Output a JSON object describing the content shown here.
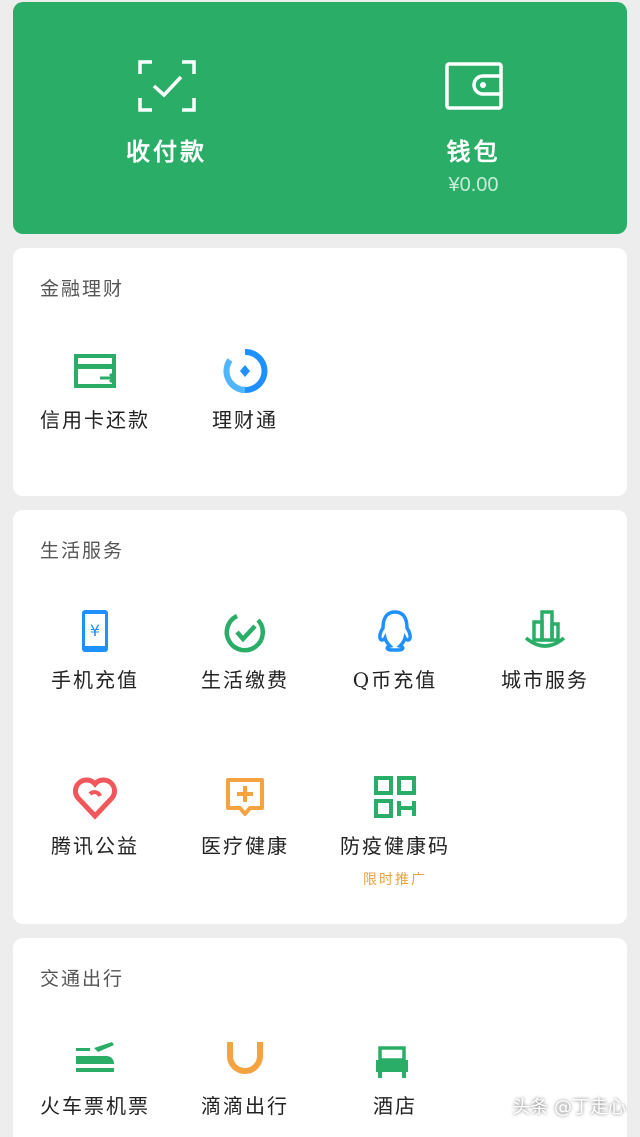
{
  "top": {
    "pay": {
      "label": "收付款",
      "icon": "scan-check-icon"
    },
    "wallet": {
      "label": "钱包",
      "balance": "¥0.00",
      "icon": "wallet-icon"
    }
  },
  "finance": {
    "title": "金融理财",
    "items": [
      {
        "label": "信用卡还款",
        "icon": "credit-card-icon"
      },
      {
        "label": "理财通",
        "icon": "licaitong-icon"
      }
    ]
  },
  "life": {
    "title": "生活服务",
    "items": [
      {
        "label": "手机充值",
        "icon": "mobile-recharge-icon"
      },
      {
        "label": "生活缴费",
        "icon": "utility-payment-icon"
      },
      {
        "label": "Q币充值",
        "icon": "qq-coin-icon"
      },
      {
        "label": "城市服务",
        "icon": "city-service-icon"
      },
      {
        "label": "腾讯公益",
        "icon": "charity-heart-icon"
      },
      {
        "label": "医疗健康",
        "icon": "medical-health-icon"
      },
      {
        "label": "防疫健康码",
        "icon": "qr-code-icon",
        "tag": "限时推广"
      }
    ]
  },
  "transport": {
    "title": "交通出行",
    "items": [
      {
        "label": "火车票机票",
        "icon": "train-plane-icon"
      },
      {
        "label": "滴滴出行",
        "icon": "didi-icon"
      },
      {
        "label": "酒店",
        "icon": "hotel-bed-icon"
      }
    ]
  },
  "watermark": "头条 @丁走心",
  "colors": {
    "green": "#2aae67",
    "blue": "#1e90ff",
    "red": "#f0565a",
    "orange": "#f4a340",
    "tag": "#e6a23c"
  }
}
